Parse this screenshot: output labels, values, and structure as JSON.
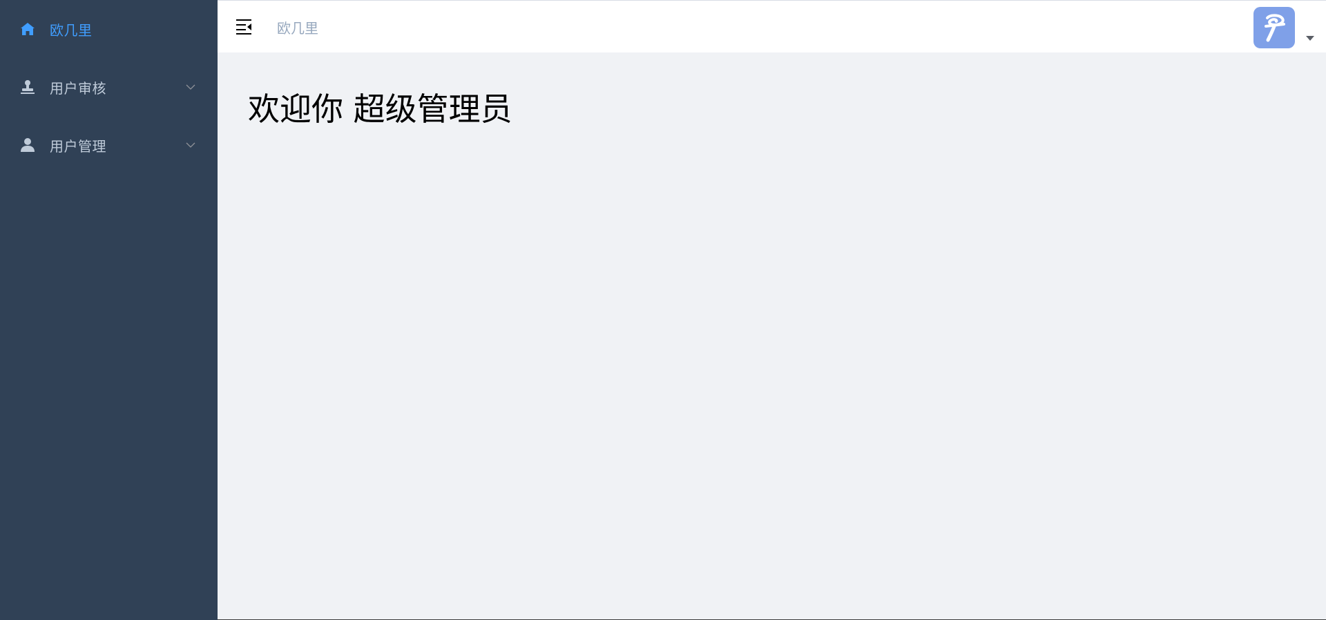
{
  "sidebar": {
    "items": [
      {
        "label": "欧几里",
        "icon": "home-icon",
        "active": true
      },
      {
        "label": "用户审核",
        "icon": "stamp-icon",
        "expandable": true
      },
      {
        "label": "用户管理",
        "icon": "user-icon",
        "expandable": true
      }
    ]
  },
  "navbar": {
    "hamburger_icon": "menu-fold-icon",
    "breadcrumb": "欧几里",
    "avatar_icon": "brand-logo-icon",
    "dropdown_icon": "caret-down-icon"
  },
  "main": {
    "welcome_text": "欢迎你 超级管理员"
  },
  "colors": {
    "sidebar_bg": "#304156",
    "sidebar_text": "#bfcbd9",
    "active_text": "#409eff",
    "content_bg": "#f0f2f5",
    "avatar_bg": "#7fa0e8"
  }
}
